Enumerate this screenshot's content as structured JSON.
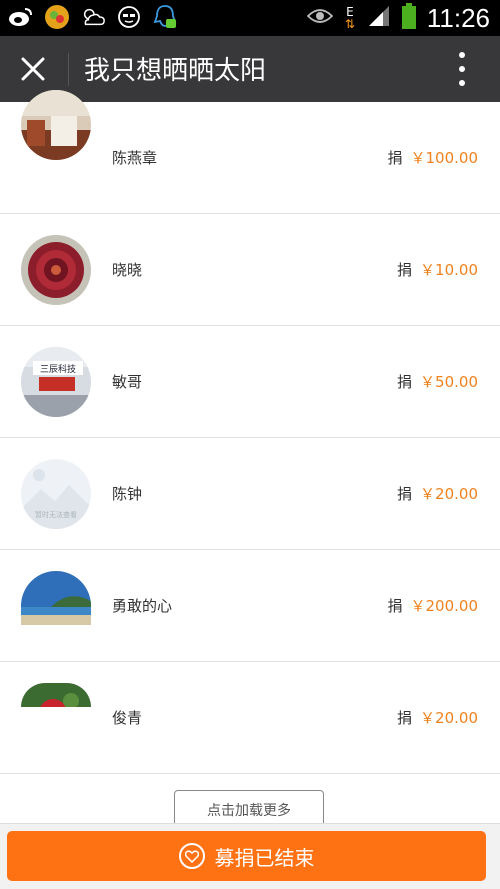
{
  "status_bar": {
    "time": "11:26",
    "network_label": "E"
  },
  "app_bar": {
    "title": "我只想晒晒太阳"
  },
  "donors": [
    {
      "name": "陈燕章",
      "donate_label": "捐",
      "amount": "￥100.00",
      "avatar": "room-photo"
    },
    {
      "name": "晓晓",
      "donate_label": "捐",
      "amount": "￥10.00",
      "avatar": "succulent-photo"
    },
    {
      "name": "敏哥",
      "donate_label": "捐",
      "amount": "￥50.00",
      "avatar": "office-sign-photo"
    },
    {
      "name": "陈钟",
      "donate_label": "捐",
      "amount": "￥20.00",
      "avatar": "placeholder-image"
    },
    {
      "name": "勇敢的心",
      "donate_label": "捐",
      "amount": "￥200.00",
      "avatar": "beach-photo"
    },
    {
      "name": "俊青",
      "donate_label": "捐",
      "amount": "￥20.00",
      "avatar": "fruit-photo"
    }
  ],
  "avatar_texts": {
    "office_sign": "三辰科技",
    "placeholder": "暂时无法查看"
  },
  "load_more_label": "点击加载更多",
  "bottom_button_label": "募捐已结束",
  "colors": {
    "accent": "#ff7214",
    "amount": "#f0821e",
    "app_bar": "#38383a"
  }
}
